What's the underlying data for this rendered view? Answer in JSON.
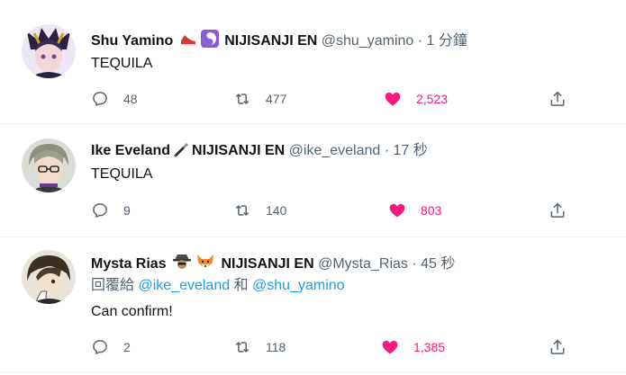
{
  "tweets": [
    {
      "name": "Shu Yamino",
      "suffix": "NIJISANJI EN",
      "handle": "@shu_yamino",
      "time": "· 1 分鐘",
      "text": "TEQUILA",
      "replies": "48",
      "retweets": "477",
      "likes": "2,523",
      "emojis": [
        "sneaker-icon",
        "yin-yang-icon"
      ]
    },
    {
      "name": "Ike Eveland",
      "suffix": "NIJISANJI EN",
      "handle": "@ike_eveland",
      "time": "· 17 秒",
      "text": "TEQUILA",
      "replies": "9",
      "retweets": "140",
      "likes": "803",
      "emojis": [
        "fountain-pen-icon"
      ]
    },
    {
      "name": "Mysta Rias",
      "suffix": "NIJISANJI EN",
      "handle": "@Mysta_Rias",
      "time": "· 45 秒",
      "reply_prefix": "回覆給",
      "reply_mention_1": "@ike_eveland",
      "reply_and": "和",
      "reply_mention_2": "@shu_yamino",
      "text": "Can confirm!",
      "replies": "2",
      "retweets": "118",
      "likes": "1,385",
      "emojis": [
        "detective-icon",
        "fox-icon"
      ]
    }
  ],
  "colors": {
    "like": "#f91880",
    "mention": "#1d9bf0",
    "secondary": "#536471"
  }
}
